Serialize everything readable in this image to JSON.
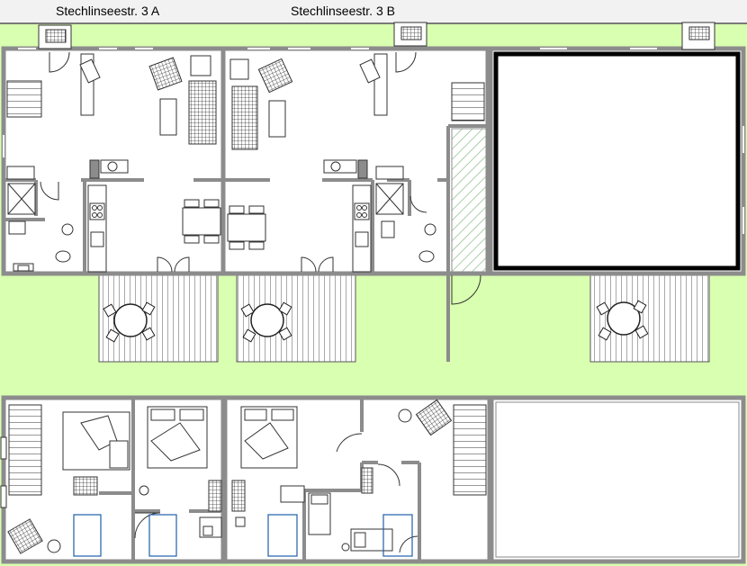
{
  "header": {
    "address_a": "Stechlinseestr. 3 A",
    "address_b": "Stechlinseestr. 3 B"
  },
  "colors": {
    "background": "#d9ffb0",
    "wall": "#8c8c8c",
    "floor": "#ffffff",
    "furniture_stroke": "#222222",
    "bed_outline": "#1f5fa8"
  }
}
